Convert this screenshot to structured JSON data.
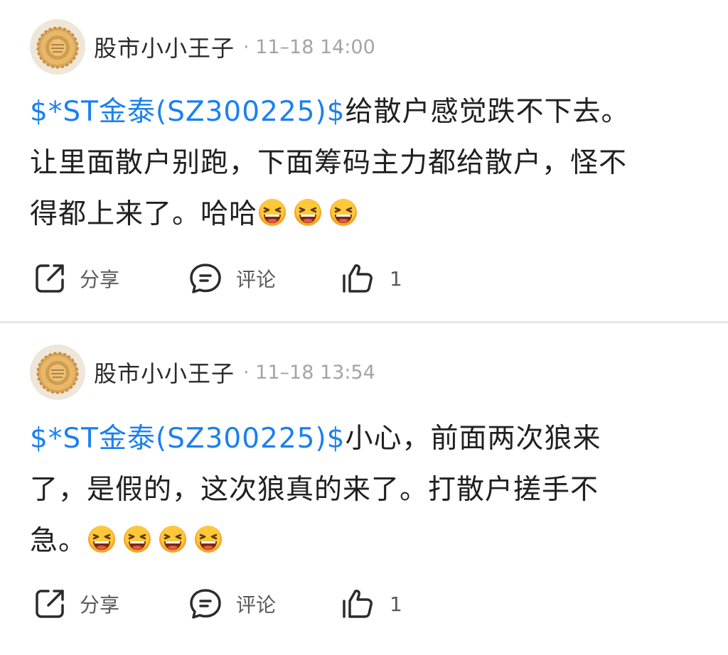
{
  "posts": [
    {
      "author": "股市小小王子",
      "meta": "· 11–18 14:00",
      "stock_tag": "$*ST金泰(SZ300225)$",
      "lines": [
        "给散户感觉跌不下去。",
        "让里面散户别跑，下面筹码主力都给散户，怪不",
        "得都上来了。哈哈"
      ],
      "emoji_count": 3,
      "share_label": "分享",
      "comment_label": "评论",
      "like_count": "1"
    },
    {
      "author": "股市小小王子",
      "meta": "· 11–18 13:54",
      "stock_tag": "$*ST金泰(SZ300225)$",
      "lines": [
        "小心，前面两次狼来",
        "了，是假的，这次狼真的来了。打散户搓手不",
        "急。"
      ],
      "emoji_count": 4,
      "share_label": "分享",
      "comment_label": "评论",
      "like_count": "1"
    }
  ],
  "icons": {
    "avatar": "mooncake-avatar",
    "emoji": "laughing-face-emoji",
    "share": "share-icon",
    "comment": "comment-icon",
    "like": "thumbs-up-icon"
  },
  "colors": {
    "stock_link": "#1a80f0",
    "meta_text": "#a4a4a4",
    "action_text": "#5a5a5a",
    "divider": "#e7e7e7",
    "emoji_face": "#f5a623"
  }
}
